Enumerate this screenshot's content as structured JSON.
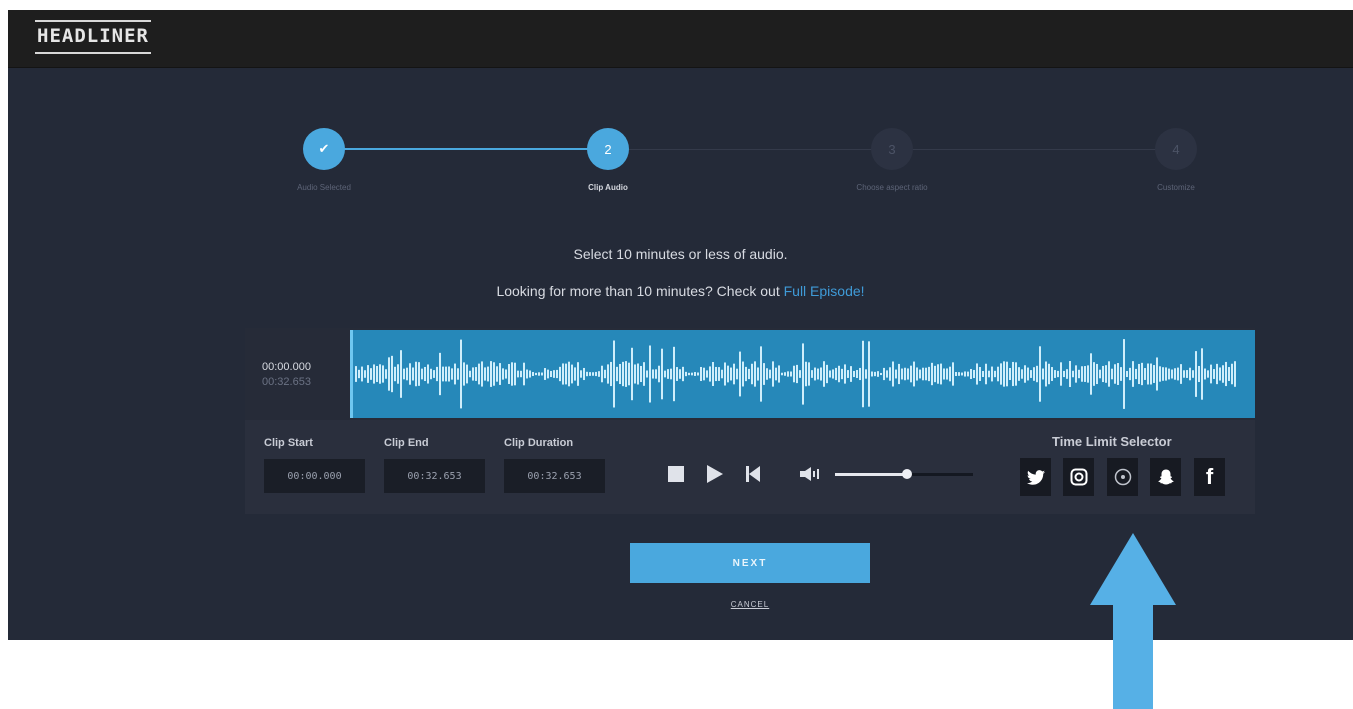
{
  "app": {
    "logo": "HEADLINER"
  },
  "steps": [
    {
      "label": "Audio Selected",
      "marker": "✔",
      "state": "done"
    },
    {
      "label": "Clip Audio",
      "marker": "2",
      "state": "current"
    },
    {
      "label": "Choose aspect ratio",
      "marker": "3",
      "state": "upcoming"
    },
    {
      "label": "Customize",
      "marker": "4",
      "state": "upcoming"
    }
  ],
  "instructions": {
    "line1": "Select 10 minutes or less of audio.",
    "line2": "Looking for more than 10 minutes? Check out",
    "link": "Full Episode!"
  },
  "player": {
    "current_time": "00:00.000",
    "total_time": "00:32.653",
    "clip_start_label": "Clip Start",
    "clip_start_value": "00:00.000",
    "clip_end_label": "Clip End",
    "clip_end_value": "00:32.653",
    "clip_duration_label": "Clip Duration",
    "clip_duration_value": "00:32.653",
    "volume_level": 0.52,
    "icons": [
      "stop-icon",
      "play-icon",
      "skip-to-start-icon",
      "volume-icon"
    ]
  },
  "time_limit": {
    "label": "Time Limit Selector",
    "platforms": [
      {
        "icon": "twitter-icon"
      },
      {
        "icon": "instagram-icon"
      },
      {
        "icon": "music-disc-icon"
      },
      {
        "icon": "snapchat-icon"
      },
      {
        "icon": "facebook-icon",
        "glyph": "f"
      }
    ]
  },
  "actions": {
    "next_label": "NEXT",
    "cancel_label": "CANCEL"
  },
  "colors": {
    "accent": "#4aa8de",
    "arrow": "#56b0e6",
    "background": "#242a38",
    "waveform": "#2688b9"
  }
}
